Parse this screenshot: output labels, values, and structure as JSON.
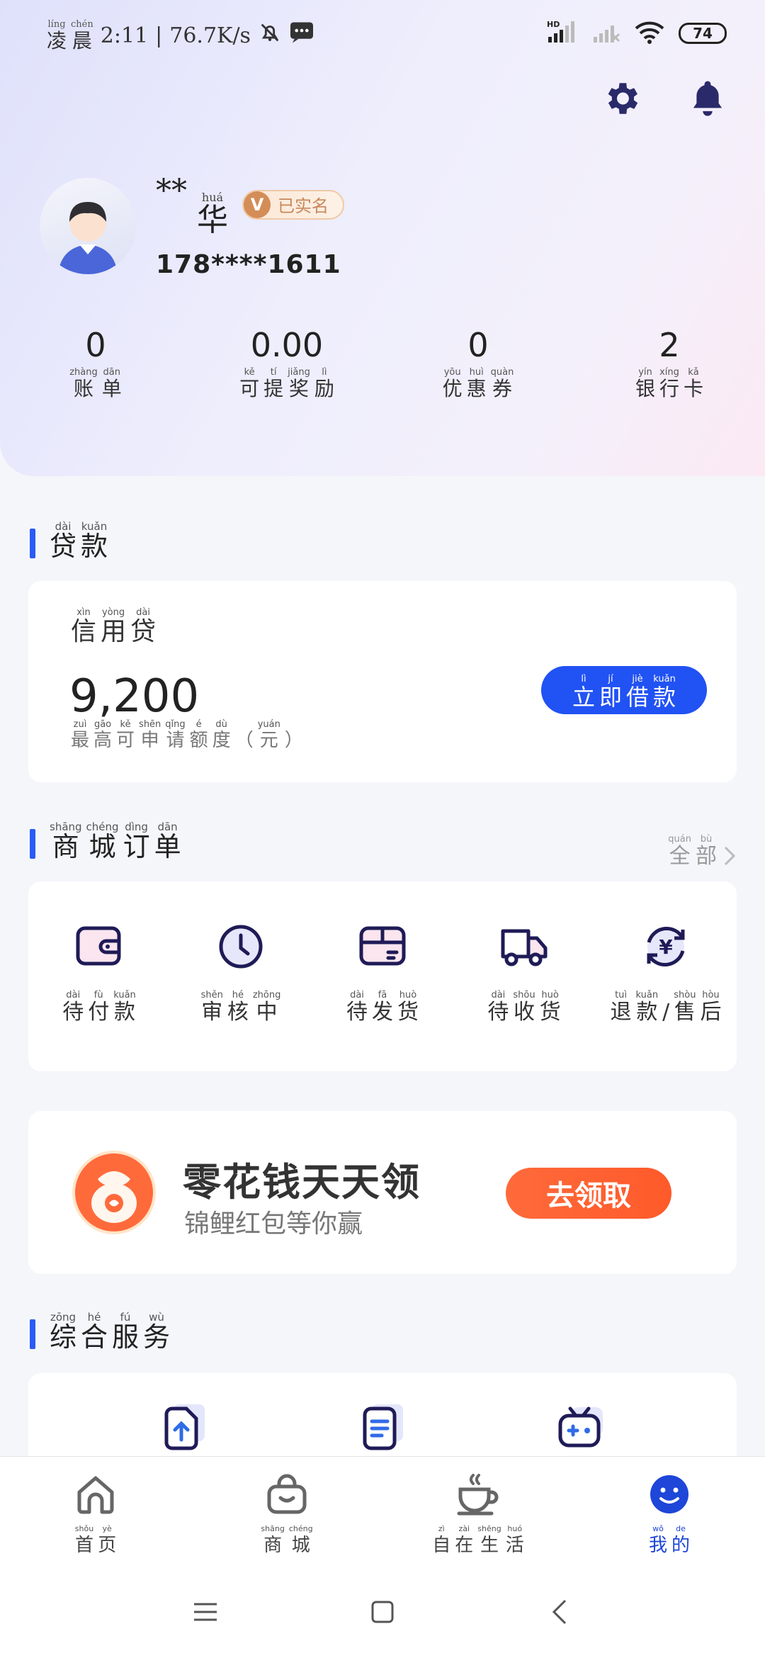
{
  "status": {
    "time_prefix": "凌晨",
    "time_prefix_pinyin": [
      "líng",
      "chén"
    ],
    "time": "2:11",
    "speed": "76.7K/s",
    "battery": "74",
    "network": "HD"
  },
  "profile": {
    "name_mask": "**",
    "name_char": "华",
    "name_char_pinyin": "huá",
    "badge": "已实名",
    "badge_icon": "V",
    "phone": "178****1611"
  },
  "stats": [
    {
      "value": "0",
      "label": [
        [
          "zhàng",
          "账"
        ],
        [
          "dān",
          "单"
        ]
      ]
    },
    {
      "value": "0.00",
      "label": [
        [
          "kě",
          "可"
        ],
        [
          "tí",
          "提"
        ],
        [
          "jiǎng",
          "奖"
        ],
        [
          "lì",
          "励"
        ]
      ]
    },
    {
      "value": "0",
      "label": [
        [
          "yōu",
          "优"
        ],
        [
          "huì",
          "惠"
        ],
        [
          "quàn",
          "券"
        ]
      ]
    },
    {
      "value": "2",
      "label": [
        [
          "yín",
          "银"
        ],
        [
          "xíng",
          "行"
        ],
        [
          "kǎ",
          "卡"
        ]
      ]
    }
  ],
  "loan": {
    "section_title": [
      [
        "dài",
        "贷"
      ],
      [
        "kuǎn",
        "款"
      ]
    ],
    "product": [
      [
        "xìn",
        "信"
      ],
      [
        "yòng",
        "用"
      ],
      [
        "dài",
        "贷"
      ]
    ],
    "amount": "9,200",
    "amount_label": [
      [
        "zuì",
        "最"
      ],
      [
        "gāo",
        "高"
      ],
      [
        "kě",
        "可"
      ],
      [
        "shēn",
        "申"
      ],
      [
        "qǐng",
        "请"
      ],
      [
        "é",
        "额"
      ],
      [
        "dù",
        "度"
      ],
      [
        "",
        "（"
      ],
      [
        "yuán",
        "元"
      ],
      [
        "",
        "）"
      ]
    ],
    "button": [
      [
        "lì",
        "立"
      ],
      [
        "jí",
        "即"
      ],
      [
        "jiè",
        "借"
      ],
      [
        "kuǎn",
        "款"
      ]
    ]
  },
  "orders": {
    "section_title": [
      [
        "shāng",
        "商"
      ],
      [
        "chéng",
        "城"
      ],
      [
        "dìng",
        "订"
      ],
      [
        "dān",
        "单"
      ]
    ],
    "all_link": [
      [
        "quán",
        "全"
      ],
      [
        "bù",
        "部"
      ]
    ],
    "items": [
      {
        "icon": "wallet-icon",
        "label": [
          [
            "dài",
            "待"
          ],
          [
            "fù",
            "付"
          ],
          [
            "kuǎn",
            "款"
          ]
        ]
      },
      {
        "icon": "clock-icon",
        "label": [
          [
            "shěn",
            "审"
          ],
          [
            "hé",
            "核"
          ],
          [
            "zhōng",
            "中"
          ]
        ]
      },
      {
        "icon": "package-icon",
        "label": [
          [
            "dài",
            "待"
          ],
          [
            "fā",
            "发"
          ],
          [
            "huò",
            "货"
          ]
        ]
      },
      {
        "icon": "truck-icon",
        "label": [
          [
            "dài",
            "待"
          ],
          [
            "shōu",
            "收"
          ],
          [
            "huò",
            "货"
          ]
        ]
      },
      {
        "icon": "refund-icon",
        "label": [
          [
            "tuì",
            "退"
          ],
          [
            "kuǎn",
            "款"
          ],
          [
            "",
            ""
          ],
          [
            "shòu",
            "售"
          ],
          [
            "hòu",
            "后"
          ]
        ]
      }
    ]
  },
  "promo": {
    "title": "零花钱天天领",
    "subtitle": "锦鲤红包等你赢",
    "button": "去领取"
  },
  "services": {
    "section_title": [
      [
        "zōng",
        "综"
      ],
      [
        "hé",
        "合"
      ],
      [
        "fú",
        "服"
      ],
      [
        "wù",
        "务"
      ]
    ]
  },
  "tabbar": [
    {
      "icon": "home-icon",
      "label": [
        [
          "shǒu",
          "首"
        ],
        [
          "yè",
          "页"
        ]
      ],
      "active": false
    },
    {
      "icon": "shop-bag-icon",
      "label": [
        [
          "shāng",
          "商"
        ],
        [
          "chéng",
          "城"
        ]
      ],
      "active": false
    },
    {
      "icon": "coffee-cup-icon",
      "label": [
        [
          "zì",
          "自"
        ],
        [
          "zài",
          "在"
        ],
        [
          "shēng",
          "生"
        ],
        [
          "huó",
          "活"
        ]
      ],
      "active": false
    },
    {
      "icon": "smile-icon",
      "label": [
        [
          "wǒ",
          "我"
        ],
        [
          "de",
          "的"
        ]
      ],
      "active": true
    }
  ],
  "colors": {
    "accent": "#2152f3",
    "icon_dark": "#2a2a6a",
    "promo_orange": "#ff5a2a",
    "badge_gold": "#d48d57"
  }
}
